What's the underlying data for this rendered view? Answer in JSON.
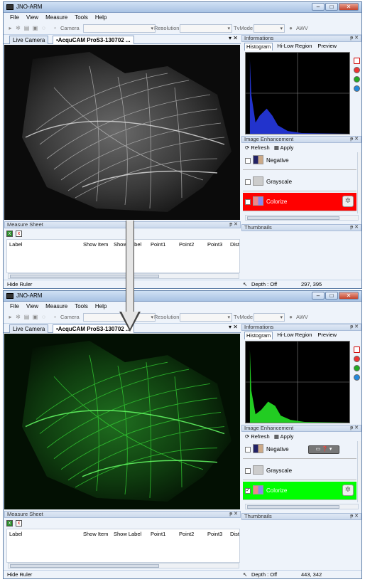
{
  "app_title": "JNO-ARM",
  "menu": [
    "File",
    "View",
    "Measure",
    "Tools",
    "Help"
  ],
  "toolbar": {
    "camera_label": "Camera",
    "resolution_label": "Resolution",
    "tvmode_label": "TvMode",
    "awv_label": "AWV"
  },
  "tabs": [
    "Live Camera",
    "•AcquCAM ProS3-130702 ..."
  ],
  "tab_controls": "▾ ✕",
  "measure_sheet": {
    "title": "Measure Sheet",
    "columns": [
      "Label",
      "Show Item",
      "Show Label",
      "Point1",
      "Point2",
      "Point3",
      "Dist"
    ],
    "columns_win2": [
      "Label",
      "Show Item",
      "Show Label",
      "Point1",
      "Point2",
      "Point3",
      "Dist"
    ]
  },
  "status": {
    "hide_ruler": "Hide Ruler",
    "depth": "Depth : Off",
    "coords_1": "297, 395",
    "coords_2": "443, 342"
  },
  "informations": {
    "title": "Informations",
    "subtabs": [
      "Histogram",
      "Hi-Low Region",
      "Preview"
    ]
  },
  "histogram_colors": {
    "win1": "#2233cc",
    "win2": "#22cc22"
  },
  "histo_buttons": [
    "#cc2222",
    "#ee3333",
    "#22aa22",
    "#2288dd"
  ],
  "image_enhancement": {
    "title": "Image Enhancement",
    "refresh": "Refresh",
    "apply": "Apply",
    "items": [
      "Negative",
      "Grayscale",
      "Colorize"
    ]
  },
  "thumbnails": {
    "title": "Thumbnails"
  },
  "panel_controls": "ᵽ ✕",
  "viewer_tint": {
    "win1": "#d8d8d8",
    "win2": "#3fe03f"
  },
  "colorize_colors": {
    "win1": "#ff0000",
    "win2": "#00ff00"
  }
}
